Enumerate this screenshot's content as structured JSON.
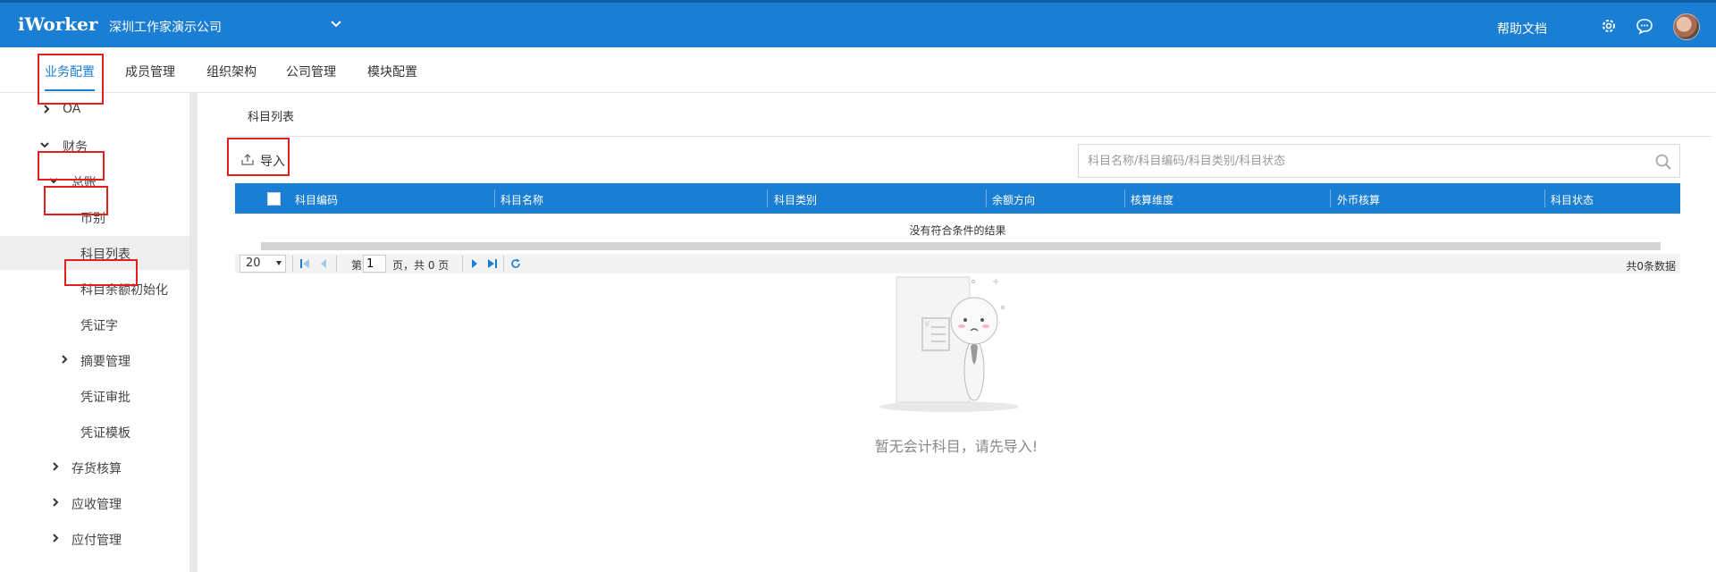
{
  "header": {
    "logo": "iWorker",
    "company": "深圳工作家演示公司",
    "help": "帮助文档",
    "icons": [
      "chevron-down-icon",
      "gear-icon",
      "chat-icon",
      "avatar"
    ]
  },
  "subnav": {
    "items": [
      "业务配置",
      "成员管理",
      "组织架构",
      "公司管理",
      "模块配置"
    ],
    "active_index": 0
  },
  "sidebar": {
    "items": [
      {
        "label": "OA",
        "level": 0,
        "expanded": false
      },
      {
        "label": "财务",
        "level": 0,
        "expanded": true
      },
      {
        "label": "总账",
        "level": 1,
        "expanded": true
      },
      {
        "label": "币别",
        "level": 2
      },
      {
        "label": "科目列表",
        "level": 2,
        "selected": true
      },
      {
        "label": "科目余额初始化",
        "level": 2
      },
      {
        "label": "凭证字",
        "level": 2
      },
      {
        "label": "摘要管理",
        "level": 2,
        "expanded": false
      },
      {
        "label": "凭证审批",
        "level": 2
      },
      {
        "label": "凭证模板",
        "level": 2
      },
      {
        "label": "存货核算",
        "level": 1,
        "expanded": false
      },
      {
        "label": "应收管理",
        "level": 1,
        "expanded": false
      },
      {
        "label": "应付管理",
        "level": 1,
        "expanded": false
      }
    ]
  },
  "main": {
    "breadcrumb": "科目列表",
    "import_label": "导入",
    "search_placeholder": "科目名称/科目编码/科目类别/科目状态",
    "table": {
      "columns": [
        "科目编码",
        "科目名称",
        "科目类别",
        "余额方向",
        "核算维度",
        "外币核算",
        "科目状态"
      ],
      "no_result": "没有符合条件的结果"
    },
    "pager": {
      "page_size": "20",
      "page_prefix": "第",
      "page_value": "1",
      "page_suffix": "页，共 0 页",
      "total": "共0条数据"
    },
    "empty_text": "暂无会计科目，请先导入!"
  },
  "colors": {
    "primary": "#1a7ed4",
    "highlight_box": "#e02020"
  }
}
